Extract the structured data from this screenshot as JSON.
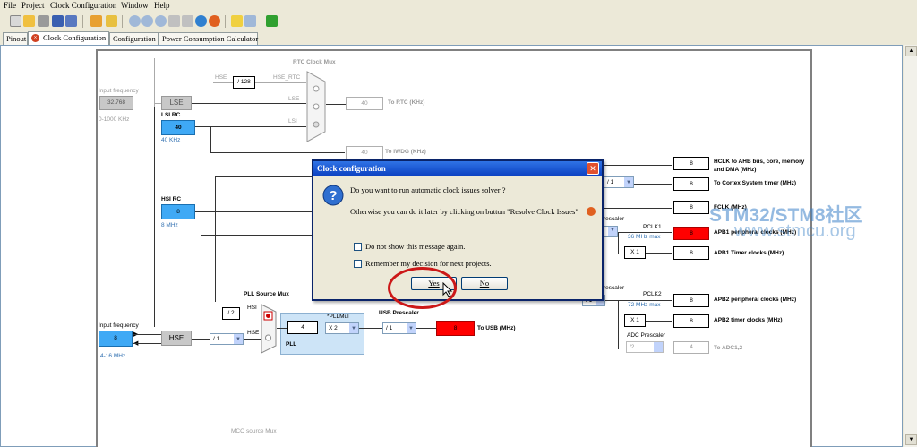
{
  "menu": [
    "File",
    "Project",
    "Clock Configuration",
    "Window",
    "Help"
  ],
  "tabs": [
    "Pinout",
    "Clock Configuration",
    "Configuration",
    "Power Consumption Calculator"
  ],
  "diagram": {
    "rtc_mux_label": "RTC Clock Mux",
    "hse_label": "HSE",
    "div128": "/ 128",
    "hse_rtc": "HSE_RTC",
    "lse_in": "LSE",
    "lsi_in": "LSI",
    "input_frequency_label": "Input frequency",
    "lse_input_value": "32.768",
    "lse_range": "0-1000 KHz",
    "lse_box": "LSE",
    "lsi_rc_label": "LSI RC",
    "lsi_value": "40",
    "lsi_freq": "40 KHz",
    "rtc_value": "40",
    "to_rtc": "To RTC (KHz)",
    "iwdg_value": "40",
    "to_iwdg": "To IWDG (KHz)",
    "hsi_rc_label": "HSI RC",
    "hsi_value": "8",
    "hsi_freq": "8 MHz",
    "hclk_value": "8",
    "hclk_label": "HCLK to AHB bus, core, memory and DMA (MHz)",
    "ahb_div": "/ 1",
    "cortex_value": "8",
    "cortex_label": "To Cortex System timer (MHz)",
    "fclk_value": "8",
    "fclk_label": "FCLK (MHz)",
    "apb1_prescaler": "rescaler",
    "pclk1": "PCLK1",
    "pclk1_max": "36 MHz max",
    "apb1_periph_value": "8",
    "apb1_periph_label": "APB1 peripheral clocks (MHz)",
    "apb1_timer_mult": "X 1",
    "apb1_timer_value": "8",
    "apb1_timer_label": "APB1 Timer clocks (MHz)",
    "apb2_prescaler": "rescaler",
    "apb2_div": "/ 1",
    "pclk2": "PCLK2",
    "pclk2_max": "72 MHz max",
    "apb2_periph_value": "8",
    "apb2_periph_label": "APB2 peripheral clocks (MHz)",
    "apb2_timer_mult": "X 1",
    "apb2_timer_value": "8",
    "apb2_timer_label": "APB2 timer clocks (MHz)",
    "adc_prescaler_label": "ADC Prescaler",
    "adc_div": "/2",
    "adc_value": "4",
    "adc_label": "To ADC1,2",
    "pll_source_mux": "PLL Source Mux",
    "hsi_div2": "/ 2",
    "hsi_pll_in": "HSI",
    "hse_pll_in": "HSE",
    "pll_value": "4",
    "pllmul_label": "*PLLMul",
    "pllmul_value": "X 2",
    "pll_label": "PLL",
    "usb_prescaler_label": "USB Prescaler",
    "usb_div": "/ 1",
    "usb_value": "8",
    "to_usb": "To USB (MHz)",
    "hse_input_label": "Input frequency",
    "hse_input_value": "8",
    "hse_range": "4-16 MHz",
    "hse_box": "HSE",
    "hse_div": "/ 1",
    "mco_label": "MCO source Mux"
  },
  "dialog": {
    "title": "Clock configuration",
    "question": "Do you want to run automatic clock issues solver ?",
    "hint": "Otherwise you can do it later by clicking on button \"Resolve Clock Issues\"",
    "check1": "Do not show this message again.",
    "check2": "Remember my decision for next projects.",
    "yes": "Yes",
    "no": "No"
  },
  "watermark": {
    "line1": "STM32/STM8社区",
    "line2": "www.stmcu.org"
  },
  "colors": {
    "warning_red": "#ff0000",
    "source_blue": "#3fa9f5",
    "titlebar_blue": "#0a3fc0"
  }
}
